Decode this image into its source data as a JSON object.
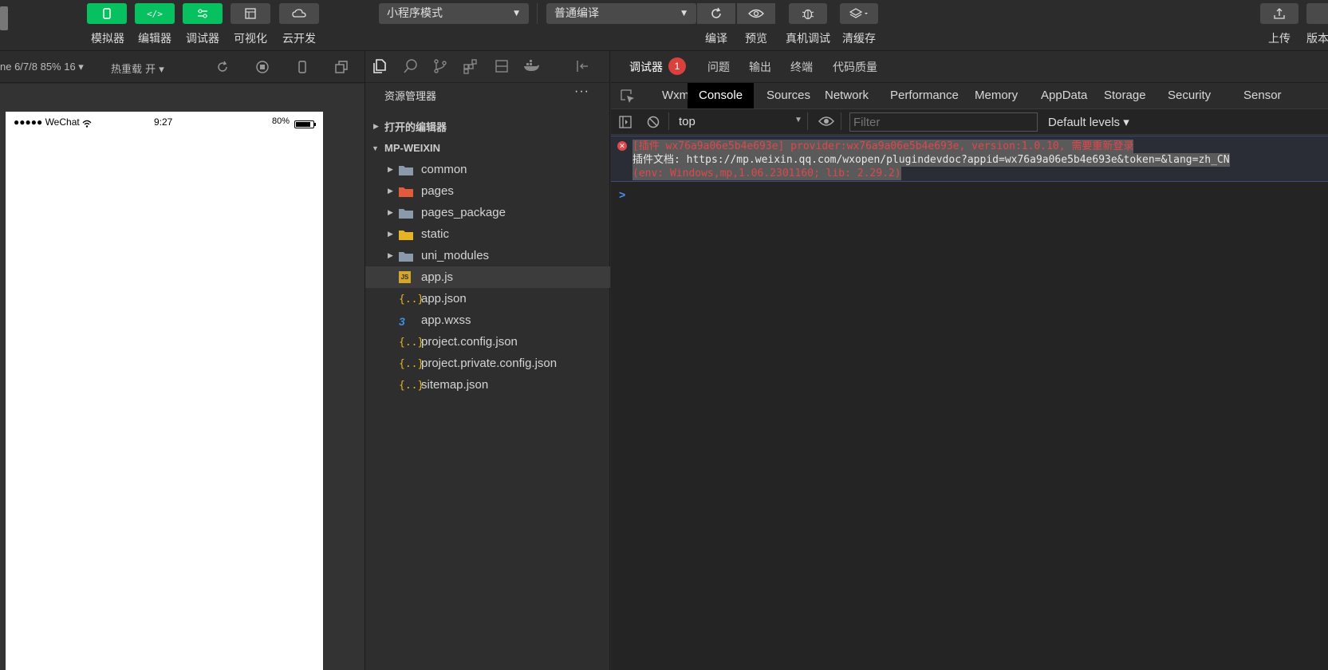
{
  "toolbar": {
    "left_buttons": [
      {
        "label": "模拟器",
        "icon": "phone-icon"
      },
      {
        "label": "编辑器",
        "icon": "code-icon"
      },
      {
        "label": "调试器",
        "icon": "sliders-icon"
      },
      {
        "label": "可视化",
        "icon": "layout-icon"
      },
      {
        "label": "云开发",
        "icon": "cloud-icon"
      }
    ],
    "mode_select": "小程序模式",
    "compile_select": "普通编译",
    "right_buttons": [
      {
        "label": "编译",
        "icon": "refresh-icon"
      },
      {
        "label": "预览",
        "icon": "eye-icon"
      },
      {
        "label": "真机调试",
        "icon": "bug-icon"
      },
      {
        "label": "清缓存",
        "icon": "layers-icon"
      }
    ],
    "upload_label": "上传",
    "version_label": "版本"
  },
  "sim_bar": {
    "device": "ne 6/7/8 85% 16 ▾",
    "hot_reload": "热重载 开 ▾"
  },
  "phone": {
    "carrier": "●●●●● WeChat",
    "time": "9:27",
    "battery": "80%"
  },
  "explorer": {
    "title": "资源管理器",
    "more": "···",
    "open_editors": "打开的编辑器",
    "project": "MP-WEIXIN",
    "items": [
      {
        "name": "common",
        "type": "folder"
      },
      {
        "name": "pages",
        "type": "folder-pages"
      },
      {
        "name": "pages_package",
        "type": "folder"
      },
      {
        "name": "static",
        "type": "folder-static"
      },
      {
        "name": "uni_modules",
        "type": "folder"
      },
      {
        "name": "app.js",
        "type": "js"
      },
      {
        "name": "app.json",
        "type": "json"
      },
      {
        "name": "app.wxss",
        "type": "css"
      },
      {
        "name": "project.config.json",
        "type": "json"
      },
      {
        "name": "project.private.config.json",
        "type": "json"
      },
      {
        "name": "sitemap.json",
        "type": "json"
      }
    ]
  },
  "devtools": {
    "top_tabs": [
      "调试器",
      "问题",
      "输出",
      "终端",
      "代码质量"
    ],
    "badge": "1",
    "tabs": [
      "Wxml",
      "Console",
      "Sources",
      "Network",
      "Performance",
      "Memory",
      "AppData",
      "Storage",
      "Security",
      "Sensor"
    ],
    "context": "top",
    "filter_placeholder": "Filter",
    "levels": "Default levels ▾",
    "error_lines": [
      "[插件 wx76a9a06e5b4e693e] provider:wx76a9a06e5b4e693e, version:1.0.10, 需要重新登录",
      "插件文档: https://mp.weixin.qq.com/wxopen/plugindevdoc?appid=wx76a9a06e5b4e693e&token=&lang=zh_CN",
      "(env: Windows,mp,1.06.2301160; lib: 2.29.2)"
    ],
    "prompt": ">"
  },
  "colors": {
    "accent": "#07c160",
    "error": "#e0474c",
    "link": "#e6e6e6"
  }
}
